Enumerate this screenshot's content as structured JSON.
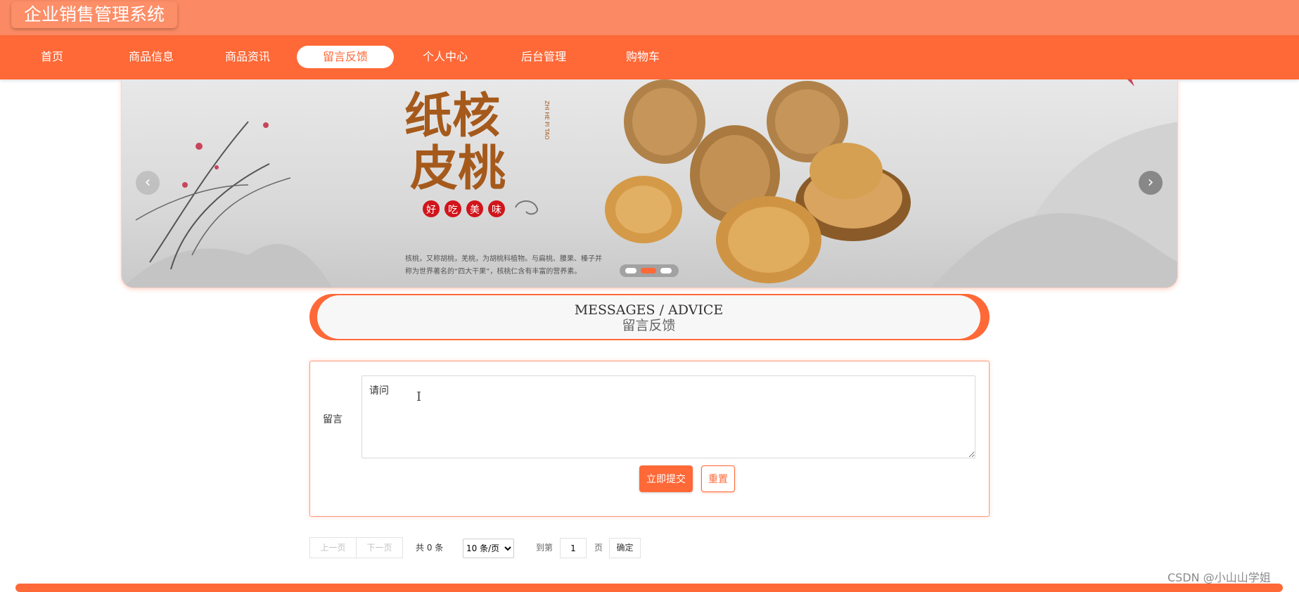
{
  "app": {
    "title": "企业销售管理系统"
  },
  "nav": {
    "items": [
      {
        "label": "首页"
      },
      {
        "label": "商品信息"
      },
      {
        "label": "商品资讯"
      },
      {
        "label": "留言反馈",
        "active": true
      },
      {
        "label": "个人中心"
      },
      {
        "label": "后台管理"
      },
      {
        "label": "购物车"
      }
    ]
  },
  "banner": {
    "title_line1": "纸核",
    "title_line2": "皮桃",
    "side_text": "ZHI HE PI TAO",
    "badges": [
      "好",
      "吃",
      "美",
      "味"
    ],
    "caption_line1": "核桃，又称胡桃，羌桃，为胡桃科植物。与扁桃、腰果、榛子并",
    "caption_line2": "称为世界著名的“四大干果”，核桃仁含有丰富的营养素。",
    "prev_icon": "‹",
    "next_icon": "›",
    "slide_count": 3,
    "active_slide": 2
  },
  "section": {
    "title_en": "MESSAGES / ADVICE",
    "title_cn": "留言反馈"
  },
  "form": {
    "label": "留言",
    "message_value": "请问",
    "submit_label": "立即提交",
    "reset_label": "重置"
  },
  "pager": {
    "prev_label": "上一页",
    "next_label": "下一页",
    "total_text": "共 0 条",
    "page_size_option": "10 条/页",
    "goto_label": "到第",
    "page_value": "1",
    "page_unit": "页",
    "confirm_label": "确定"
  },
  "watermark": "CSDN @小山山学姐",
  "colors": {
    "primary": "#fe6937",
    "topbar": "#fb8a64"
  }
}
